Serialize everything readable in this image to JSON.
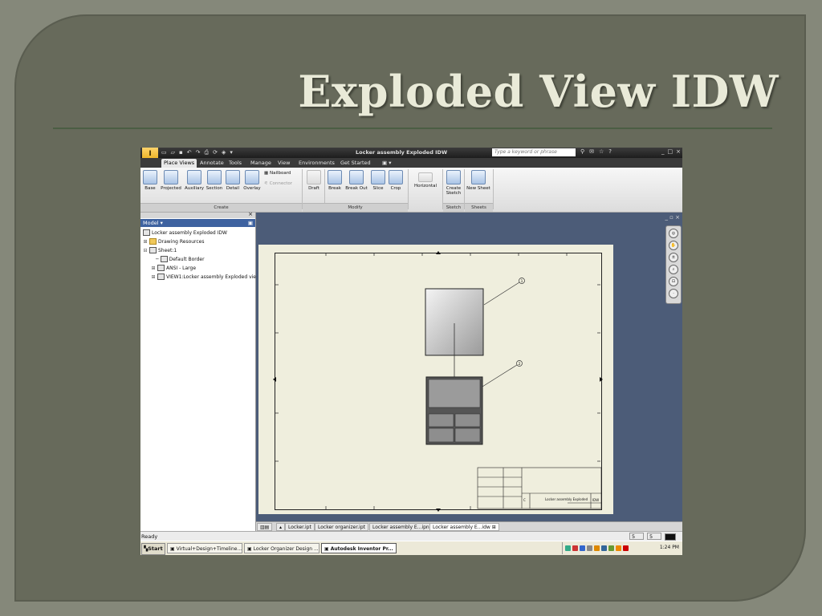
{
  "slide": {
    "title": "Exploded View IDW"
  },
  "app": {
    "window_title": "Locker assembly Exploded IDW",
    "search_placeholder": "Type a keyword or phrase",
    "tabs": [
      "Place Views",
      "Annotate",
      "Tools",
      "Manage",
      "View",
      "Environments",
      "Get Started"
    ],
    "ribbon": {
      "create_buttons": [
        "Base",
        "Projected",
        "Auxiliary",
        "Section",
        "Detail",
        "Overlay"
      ],
      "nailboard": "Nailboard",
      "connector": "Connector",
      "draft": "Draft",
      "modify_buttons": [
        "Break",
        "Break Out",
        "Slice",
        "Crop"
      ],
      "horizontal": "Horizontal",
      "create_sketch": [
        "Create",
        "Sketch"
      ],
      "new_sheet": "New Sheet",
      "groups": {
        "create": "Create",
        "modify": "Modify",
        "sketch": "Sketch",
        "sheets": "Sheets"
      }
    },
    "browser": {
      "header": "Model ▾",
      "tree": [
        "Locker assembly Exploded IDW",
        "Drawing Resources",
        "Sheet:1",
        "Default Border",
        "ANSI - Large",
        "VIEW1:Locker assembly Exploded vie"
      ]
    },
    "title_block": {
      "title": "Locker assembly Exploded",
      "size": "C",
      "dwg_label": "IDW"
    },
    "sheet_tabs": [
      "Locker.ipt",
      "Locker organizer.ipt",
      "Locker assembly E...ipn",
      "Locker assembly E...idw"
    ],
    "status": {
      "text": "Ready",
      "n1": "5",
      "n2": "5"
    }
  },
  "taskbar": {
    "start": "Start",
    "tasks": [
      "Virtual+Design+Timeline...",
      "Locker Organizer Design ...",
      "Autodesk Inventor Pr..."
    ],
    "clock": "1:24 PM"
  }
}
